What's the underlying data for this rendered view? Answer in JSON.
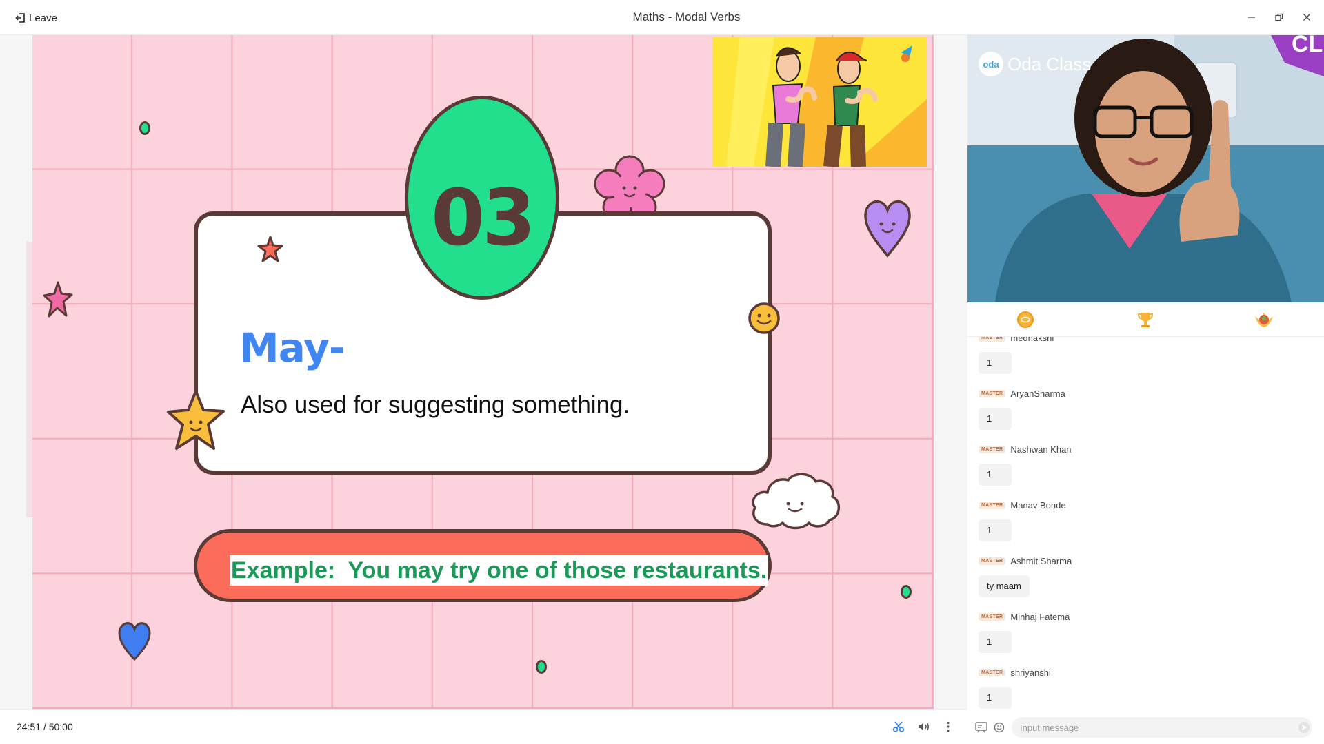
{
  "window": {
    "leave_label": "Leave",
    "title": "Maths - Modal Verbs"
  },
  "slide": {
    "number": "03",
    "heading": "May-",
    "body": "Also used for suggesting something.",
    "example": "Example:  You may try one of those restaurants."
  },
  "video": {
    "brand": "Oda Class",
    "brand_logo_text": "oda",
    "corner_text": "CL"
  },
  "chat": {
    "badge_label": "MASTER",
    "messages": [
      {
        "user": "medhakshi",
        "text": "1"
      },
      {
        "user": "AryanSharma",
        "text": "1"
      },
      {
        "user": "Nashwan Khan",
        "text": "1"
      },
      {
        "user": "Manav Bonde",
        "text": "1"
      },
      {
        "user": "Ashmit Sharma",
        "text": "ty maam"
      },
      {
        "user": "Minhaj Fatema",
        "text": "1"
      },
      {
        "user": "shriyanshi",
        "text": "1"
      }
    ],
    "input_placeholder": "Input message"
  },
  "playback": {
    "elapsed": "24:51",
    "total": "/ 50:00"
  },
  "icons": {
    "leave": "exit-icon",
    "minimize": "minimize-icon",
    "restore": "restore-icon",
    "close": "close-icon",
    "scissors": "scissors-icon",
    "volume": "volume-icon",
    "more": "more-vertical-icon",
    "coin": "coin-icon",
    "trophy": "trophy-icon",
    "avatar": "avatar-badge-icon",
    "whiteboard": "whiteboard-icon",
    "emoji": "emoji-icon",
    "send": "send-icon"
  },
  "colors": {
    "slide_bg": "#fcd2dd",
    "oval_green": "#21df8d",
    "heading_blue": "#3f86f2",
    "pill_red": "#fb6d5a",
    "example_green": "#1a9a57",
    "outline_brown": "#5a3a36"
  }
}
